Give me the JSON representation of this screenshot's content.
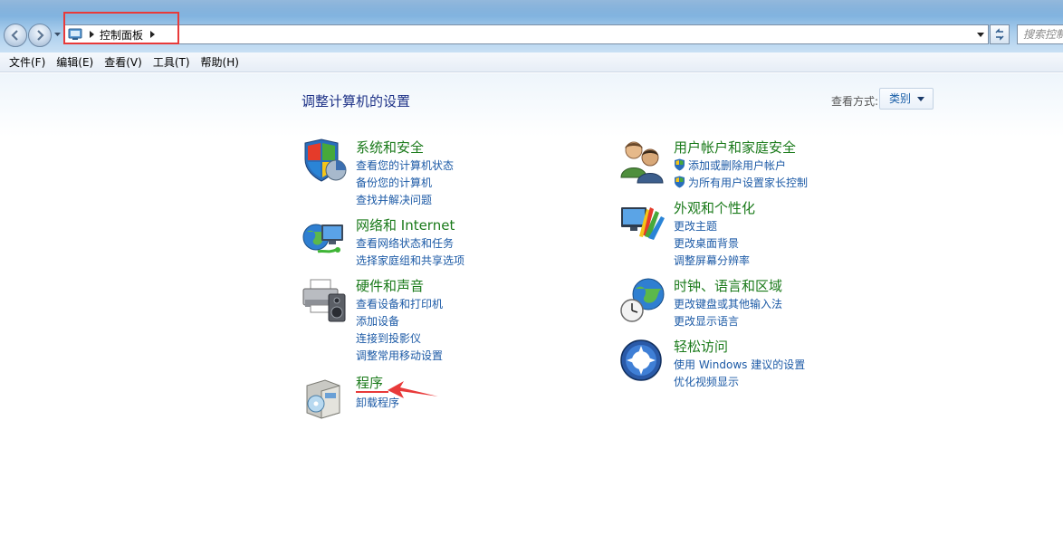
{
  "address": {
    "breadcrumb": "控制面板",
    "search_placeholder": "搜索控制面板"
  },
  "menu": [
    "文件(F)",
    "编辑(E)",
    "查看(V)",
    "工具(T)",
    "帮助(H)"
  ],
  "main": {
    "title": "调整计算机的设置",
    "view_by_label": "查看方式:",
    "view_by_value": "类别"
  },
  "categories_left": [
    {
      "title": "系统和安全",
      "links": [
        "查看您的计算机状态",
        "备份您的计算机",
        "查找并解决问题"
      ]
    },
    {
      "title": "网络和 Internet",
      "links": [
        "查看网络状态和任务",
        "选择家庭组和共享选项"
      ]
    },
    {
      "title": "硬件和声音",
      "links": [
        "查看设备和打印机",
        "添加设备",
        "连接到投影仪",
        "调整常用移动设置"
      ]
    },
    {
      "title": "程序",
      "links": [
        "卸载程序"
      ]
    }
  ],
  "categories_right": [
    {
      "title": "用户帐户和家庭安全",
      "links": [
        "添加或删除用户帐户",
        "为所有用户设置家长控制"
      ]
    },
    {
      "title": "外观和个性化",
      "links": [
        "更改主题",
        "更改桌面背景",
        "调整屏幕分辨率"
      ]
    },
    {
      "title": "时钟、语言和区域",
      "links": [
        "更改键盘或其他输入法",
        "更改显示语言"
      ]
    },
    {
      "title": "轻松访问",
      "links": [
        "使用 Windows 建议的设置",
        "优化视频显示"
      ]
    }
  ],
  "colors": {
    "category_title": "#1a7a1a",
    "link": "#1c5aa6",
    "annotation_red": "#e83a3a"
  }
}
